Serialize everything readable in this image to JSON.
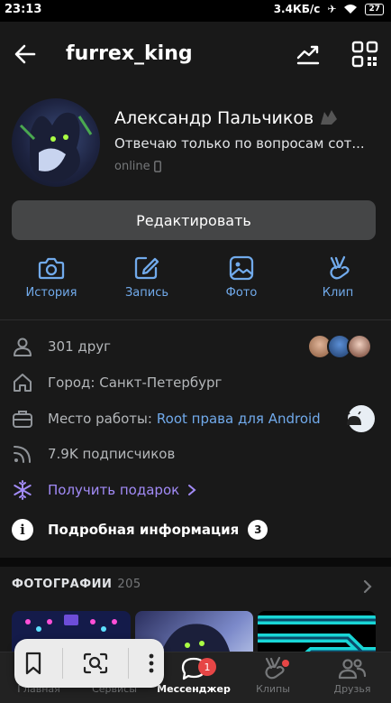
{
  "status_bar": {
    "time": "23:13",
    "net_speed": "3.4КБ/с",
    "battery": "27"
  },
  "header": {
    "username": "furrex_king"
  },
  "profile": {
    "name": "Александр Пальчиков",
    "status": "Отвечаю только по вопросам сот...",
    "online": "online",
    "edit_label": "Редактировать"
  },
  "actions": [
    {
      "label": "История",
      "icon": "camera-icon"
    },
    {
      "label": "Запись",
      "icon": "edit-icon"
    },
    {
      "label": "Фото",
      "icon": "image-icon"
    },
    {
      "label": "Клип",
      "icon": "clip-icon"
    }
  ],
  "info": {
    "friends": "301 друг",
    "city": "Город: Санкт-Петербург",
    "work_prefix": "Место работы:",
    "work_link": "Root права для Android",
    "followers": "7.9K подписчиков",
    "gift": "Получить подарок",
    "details": "Подробная информация",
    "details_count": "3"
  },
  "photos": {
    "title": "ФОТОГРАФИИ",
    "count": "205"
  },
  "tabbar": [
    {
      "label": "Главная",
      "icon": "home-icon"
    },
    {
      "label": "Сервисы",
      "icon": "services-icon"
    },
    {
      "label": "Мессенджер",
      "icon": "messenger-icon",
      "badge": "1"
    },
    {
      "label": "Клипы",
      "icon": "clips-icon"
    },
    {
      "label": "Друзья",
      "icon": "friends-icon"
    }
  ],
  "colors": {
    "accent": "#71aaeb",
    "gift": "#a28bf7",
    "background": "#191919",
    "badge": "#e64646"
  }
}
